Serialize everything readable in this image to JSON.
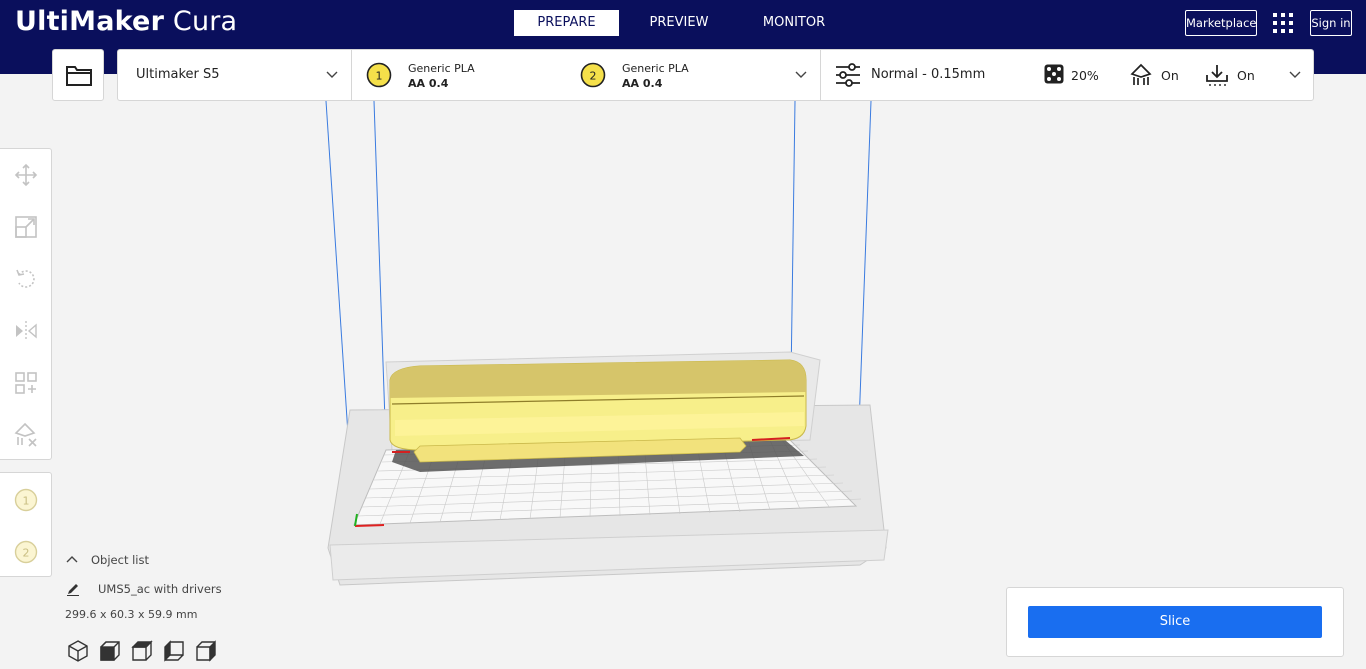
{
  "app": {
    "logo_bold": "UltiMaker",
    "logo_light": "Cura"
  },
  "header": {
    "tabs": [
      {
        "label": "PREPARE",
        "active": true
      },
      {
        "label": "PREVIEW",
        "active": false
      },
      {
        "label": "MONITOR",
        "active": false
      }
    ],
    "marketplace_label": "Marketplace",
    "apps_icon": "grid-icon",
    "signin_label": "Sign in"
  },
  "open_file": {
    "icon": "folder-icon"
  },
  "printer": {
    "name": "Ultimaker S5"
  },
  "extruders": [
    {
      "number": "1",
      "material": "Generic PLA",
      "core": "AA 0.4",
      "color": "#f5e04a"
    },
    {
      "number": "2",
      "material": "Generic PLA",
      "core": "AA 0.4",
      "color": "#f5e04a"
    }
  ],
  "print_settings": {
    "profile": "Normal - 0.15mm",
    "infill": "20%",
    "support": "On",
    "adhesion": "On"
  },
  "tools": [
    {
      "name": "move-tool",
      "icon": "move-icon"
    },
    {
      "name": "scale-tool",
      "icon": "scale-icon"
    },
    {
      "name": "rotate-tool",
      "icon": "rotate-icon"
    },
    {
      "name": "mirror-tool",
      "icon": "mirror-icon"
    },
    {
      "name": "per-model-settings-tool",
      "icon": "per-model-settings-icon"
    },
    {
      "name": "support-blocker-tool",
      "icon": "support-blocker-icon"
    }
  ],
  "extruder_tools": [
    "1",
    "2"
  ],
  "object_list": {
    "label": "Object list",
    "object_name": "UMS5_ac with drivers",
    "dimensions": "299.6 x 60.3 x 59.9 mm"
  },
  "view_buttons": [
    "3d-view",
    "front-view",
    "top-view",
    "left-view",
    "right-view"
  ],
  "slice": {
    "label": "Slice"
  },
  "colors": {
    "header_bg": "#0a0f5c",
    "accent_blue": "#196ef0",
    "model_yellow": "#f7ef8a",
    "build_volume_line": "#3a7be0"
  }
}
